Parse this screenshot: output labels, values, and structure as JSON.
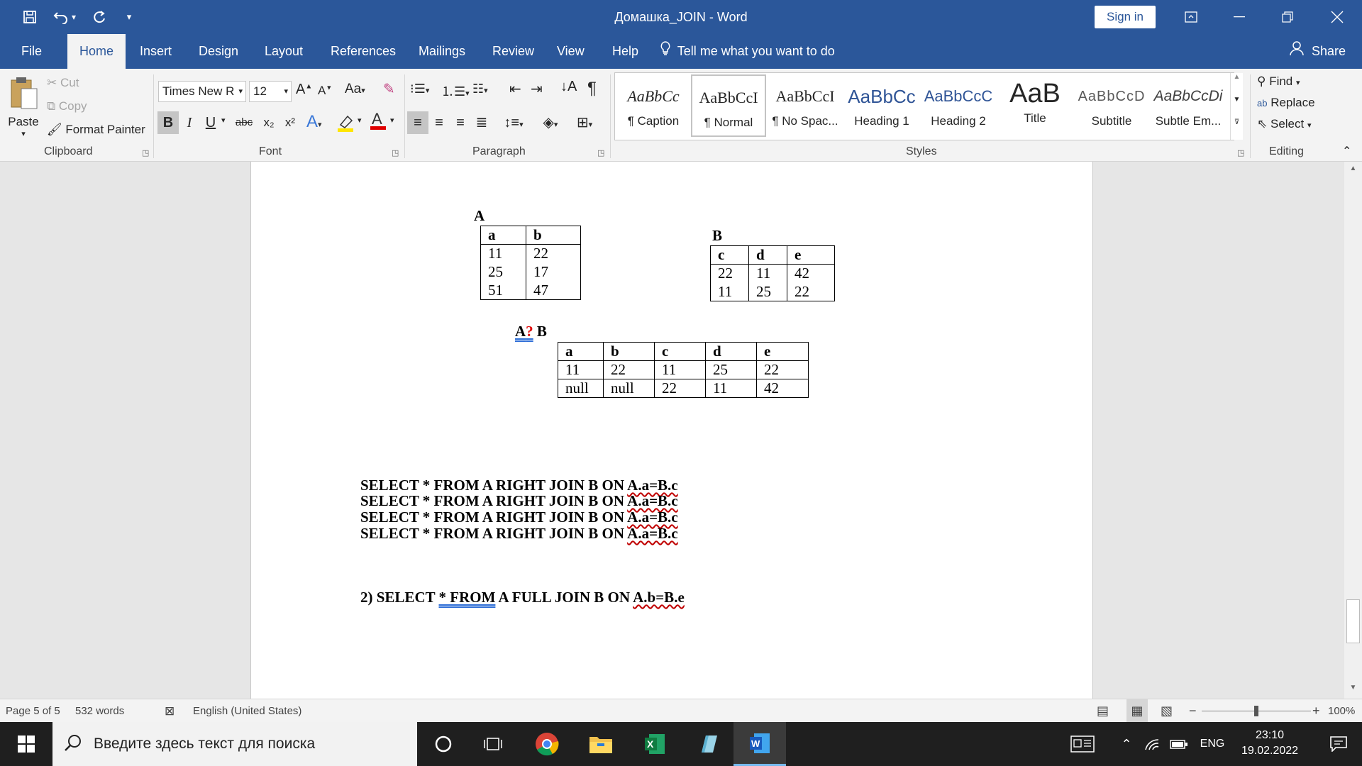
{
  "window": {
    "title": "Домашка_JOIN  -  Word",
    "signin_label": "Sign in"
  },
  "tabs": [
    "File",
    "Home",
    "Insert",
    "Design",
    "Layout",
    "References",
    "Mailings",
    "Review",
    "View",
    "Help"
  ],
  "active_tab": "Home",
  "tell_me": "Tell me what you want to do",
  "share_label": "Share",
  "clipboard": {
    "paste": "Paste",
    "cut": "Cut",
    "copy": "Copy",
    "format_painter": "Format Painter",
    "group_label": "Clipboard"
  },
  "font": {
    "name": "Times New R",
    "size": "12",
    "grow": "A",
    "shrink": "A",
    "case": "Aa",
    "bold": "B",
    "italic": "I",
    "underline": "U",
    "strike": "abc",
    "subscript": "x₂",
    "superscript": "x²",
    "group_label": "Font"
  },
  "paragraph": {
    "group_label": "Paragraph",
    "pilcrow": "¶"
  },
  "styles": {
    "group_label": "Styles",
    "items": [
      {
        "sample": "AaBbCc",
        "name": "¶ Caption"
      },
      {
        "sample": "AaBbCcI",
        "name": "¶ Normal"
      },
      {
        "sample": "AaBbCcI",
        "name": "¶ No Spac..."
      },
      {
        "sample": "AaBbCc",
        "name": "Heading 1"
      },
      {
        "sample": "AaBbCcC",
        "name": "Heading 2"
      },
      {
        "sample": "AaB",
        "name": "Title"
      },
      {
        "sample": "AaBbCcD",
        "name": "Subtitle"
      },
      {
        "sample": "AaBbCcDi",
        "name": "Subtle Em..."
      }
    ]
  },
  "editing": {
    "find": "Find",
    "replace": "Replace",
    "select": "Select",
    "group_label": "Editing"
  },
  "document": {
    "table_a": {
      "label": "A",
      "headers": [
        "a",
        "b"
      ],
      "rows": [
        [
          "11",
          "22"
        ],
        [
          "25",
          "17"
        ],
        [
          "51",
          "47"
        ]
      ]
    },
    "table_b": {
      "label": "B",
      "headers": [
        "c",
        "d",
        "e"
      ],
      "rows": [
        [
          "22",
          "11",
          "42"
        ],
        [
          "11",
          "25",
          "22"
        ]
      ]
    },
    "result": {
      "label_a": "A",
      "label_q": "?",
      "label_b": "B",
      "headers": [
        "a",
        "b",
        "c",
        "d",
        "e"
      ],
      "rows": [
        [
          "11",
          "22",
          "11",
          "25",
          "22"
        ],
        [
          "null",
          "null",
          "22",
          "11",
          "42"
        ]
      ]
    },
    "queries": [
      {
        "prefix": "SELECT * FROM A RIGHT JOIN B ON ",
        "cond": "A.a=B.c"
      },
      {
        "prefix": "SELECT * FROM A RIGHT JOIN B ON ",
        "cond": "A.a=B.c"
      },
      {
        "prefix": "SELECT * FROM A RIGHT JOIN B ON ",
        "cond": "A.a=B.c"
      },
      {
        "prefix": "SELECT * FROM A RIGHT JOIN B ON ",
        "cond": "A.a=B.c"
      }
    ],
    "query2": {
      "prefix": "2) SELECT ",
      "mid": "*  FROM",
      "rest": " A FULL JOIN B  ON ",
      "cond": "A.b=B.e"
    }
  },
  "status": {
    "page": "Page 5 of 5",
    "words": "532 words",
    "language": "English (United States)",
    "zoom": "100%",
    "zoom_level": 100
  },
  "taskbar": {
    "search_placeholder": "Введите здесь текст для поиска",
    "lang": "ENG",
    "time": "23:10",
    "date": "19.02.2022"
  },
  "colors": {
    "word_blue": "#2b579a",
    "squiggle": "#c00000",
    "red_mark": "#e00000"
  }
}
